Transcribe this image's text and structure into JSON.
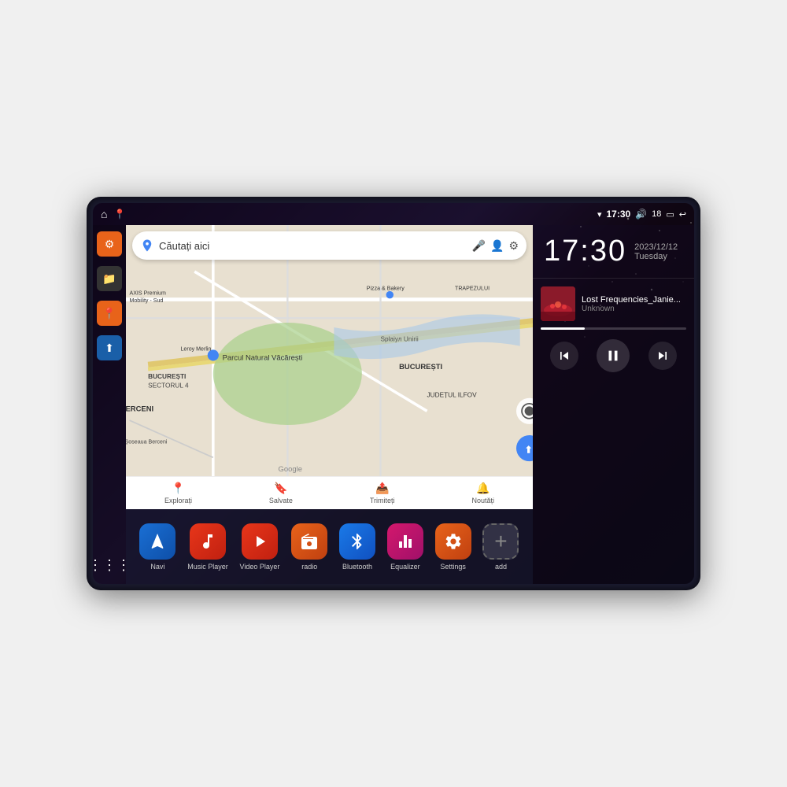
{
  "device": {
    "status_bar": {
      "left_icons": [
        "home",
        "maps"
      ],
      "time": "17:30",
      "right_icons": [
        "wifi",
        "volume",
        "18",
        "battery",
        "back"
      ],
      "wifi_icon": "▾",
      "volume_icon": "🔊",
      "battery_icon": "🔋",
      "back_icon": "↩"
    },
    "clock": {
      "time": "17:30",
      "date": "2023/12/12",
      "day": "Tuesday"
    },
    "music": {
      "song_title": "Lost Frequencies_Janie...",
      "artist": "Unknown",
      "progress": 30
    },
    "map": {
      "search_placeholder": "Căutați aici",
      "bottom_items": [
        {
          "icon": "📍",
          "label": "Explorați"
        },
        {
          "icon": "🔖",
          "label": "Salvate"
        },
        {
          "icon": "📤",
          "label": "Trimiteți"
        },
        {
          "icon": "🔔",
          "label": "Noutăți"
        }
      ]
    },
    "apps": [
      {
        "id": "navi",
        "label": "Navi",
        "icon": "⬆",
        "color_class": "icon-navi"
      },
      {
        "id": "music",
        "label": "Music Player",
        "icon": "♪",
        "color_class": "icon-music"
      },
      {
        "id": "video",
        "label": "Video Player",
        "icon": "▶",
        "color_class": "icon-video"
      },
      {
        "id": "radio",
        "label": "radio",
        "icon": "📻",
        "color_class": "icon-radio"
      },
      {
        "id": "bluetooth",
        "label": "Bluetooth",
        "icon": "⚡",
        "color_class": "icon-bluetooth"
      },
      {
        "id": "equalizer",
        "label": "Equalizer",
        "icon": "⬆",
        "color_class": "icon-equalizer"
      },
      {
        "id": "settings",
        "label": "Settings",
        "icon": "⚙",
        "color_class": "icon-settings"
      },
      {
        "id": "add",
        "label": "add",
        "icon": "+",
        "color_class": "icon-add"
      }
    ],
    "sidebar": {
      "items": [
        {
          "id": "settings",
          "icon": "⚙"
        },
        {
          "id": "files",
          "icon": "📁"
        },
        {
          "id": "maps",
          "icon": "📍"
        },
        {
          "id": "nav",
          "icon": "⬆"
        }
      ]
    }
  }
}
